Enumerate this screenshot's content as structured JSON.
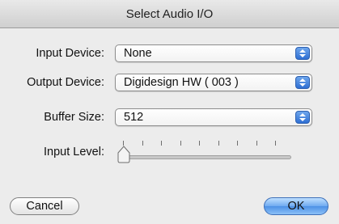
{
  "window": {
    "title": "Select Audio I/O"
  },
  "input_device": {
    "label": "Input Device:",
    "value": "None"
  },
  "output_device": {
    "label": "Output Device:",
    "value": "Digidesign HW ( 003 )"
  },
  "buffer_size": {
    "label": "Buffer Size:",
    "value": "512"
  },
  "input_level": {
    "label": "Input Level:",
    "level": 0
  },
  "buttons": {
    "cancel": "Cancel",
    "ok": "OK"
  },
  "colors": {
    "accent": "#3b7fdc",
    "background": "#ececec"
  },
  "icons": {
    "stepper": "up-down-stepper-icon",
    "slider_thumb": "slider-thumb-icon"
  }
}
